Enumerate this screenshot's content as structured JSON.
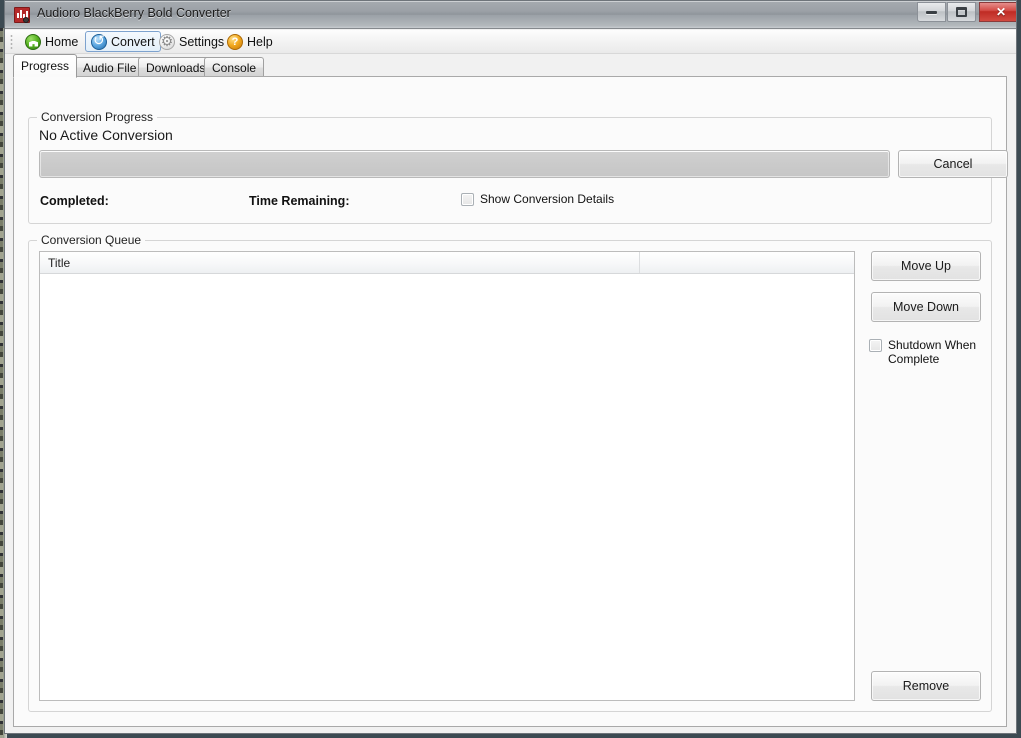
{
  "window": {
    "title": "Audioro BlackBerry Bold Converter",
    "app_icon": "audioro-app-icon",
    "controls": {
      "minimize_label": "–",
      "maximize_label": "□",
      "close_label": "✕"
    }
  },
  "toolbar": {
    "items": [
      {
        "label": "Home",
        "icon": "home-icon",
        "active": false
      },
      {
        "label": "Convert",
        "icon": "convert-icon",
        "active": true
      },
      {
        "label": "Settings",
        "icon": "gear-icon",
        "active": false
      },
      {
        "label": "Help",
        "icon": "help-icon",
        "active": false
      }
    ]
  },
  "tabs": [
    {
      "label": "Progress",
      "selected": true
    },
    {
      "label": "Audio File",
      "selected": false
    },
    {
      "label": "Downloads",
      "selected": false
    },
    {
      "label": "Console",
      "selected": false
    }
  ],
  "conversion_progress": {
    "group_title": "Conversion Progress",
    "status": "No Active Conversion",
    "progress_percent": 0,
    "completed_label": "Completed:",
    "completed_value": "",
    "time_remaining_label": "Time Remaining:",
    "time_remaining_value": "",
    "show_details_label": "Show Conversion Details",
    "show_details_checked": false,
    "cancel_label": "Cancel"
  },
  "conversion_queue": {
    "group_title": "Conversion Queue",
    "columns": [
      "Title",
      ""
    ],
    "rows": [],
    "move_up_label": "Move Up",
    "move_down_label": "Move Down",
    "shutdown_label": "Shutdown When Complete",
    "shutdown_checked": false,
    "remove_label": "Remove"
  },
  "colors": {
    "accent_selected_tab_border": "#7da2ce",
    "close_button": "#bf2b24",
    "home_icon": "#57b321",
    "convert_icon": "#1f6bab",
    "help_icon": "#f2a81e",
    "progress_trough": "#c9c9c9",
    "window_background": "#f1f1f1"
  }
}
